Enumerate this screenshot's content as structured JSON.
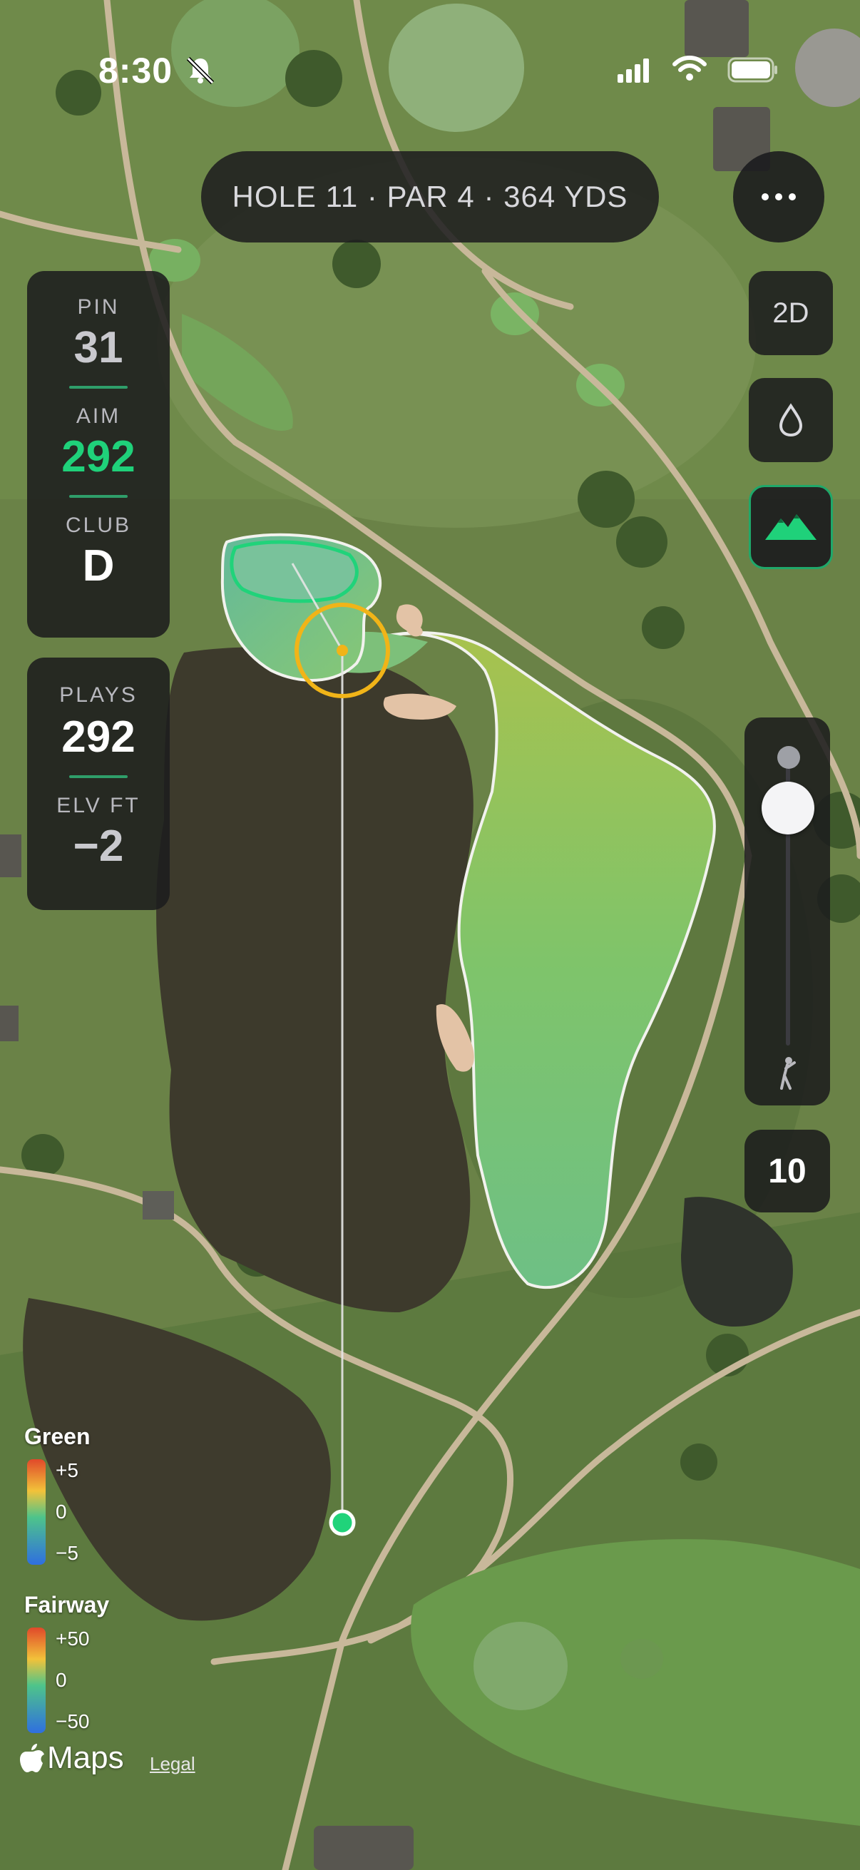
{
  "status_bar": {
    "time": "8:30"
  },
  "hole": {
    "label": "HOLE 11 · PAR 4 · 364 YDS"
  },
  "distance_panel": {
    "pin_label": "PIN",
    "pin_value": "31",
    "aim_label": "AIM",
    "aim_value": "292",
    "club_label": "CLUB",
    "club_value": "D"
  },
  "plays_panel": {
    "plays_label": "PLAYS",
    "plays_value": "292",
    "elev_label": "ELV FT",
    "elev_value": "−2"
  },
  "controls": {
    "view_label": "2D",
    "wind_icon": "drop-icon",
    "terrain_icon": "mountain-icon",
    "menu_icon": "more-icon",
    "zoom_value": "10",
    "accent_color": "#1fd17a"
  },
  "legend": {
    "green": {
      "title": "Green",
      "max": "+5",
      "mid": "0",
      "min": "−5"
    },
    "fairway": {
      "title": "Fairway",
      "max": "+50",
      "mid": "0",
      "min": "−50"
    }
  },
  "attribution": {
    "maps": "Maps",
    "legal": "Legal"
  }
}
